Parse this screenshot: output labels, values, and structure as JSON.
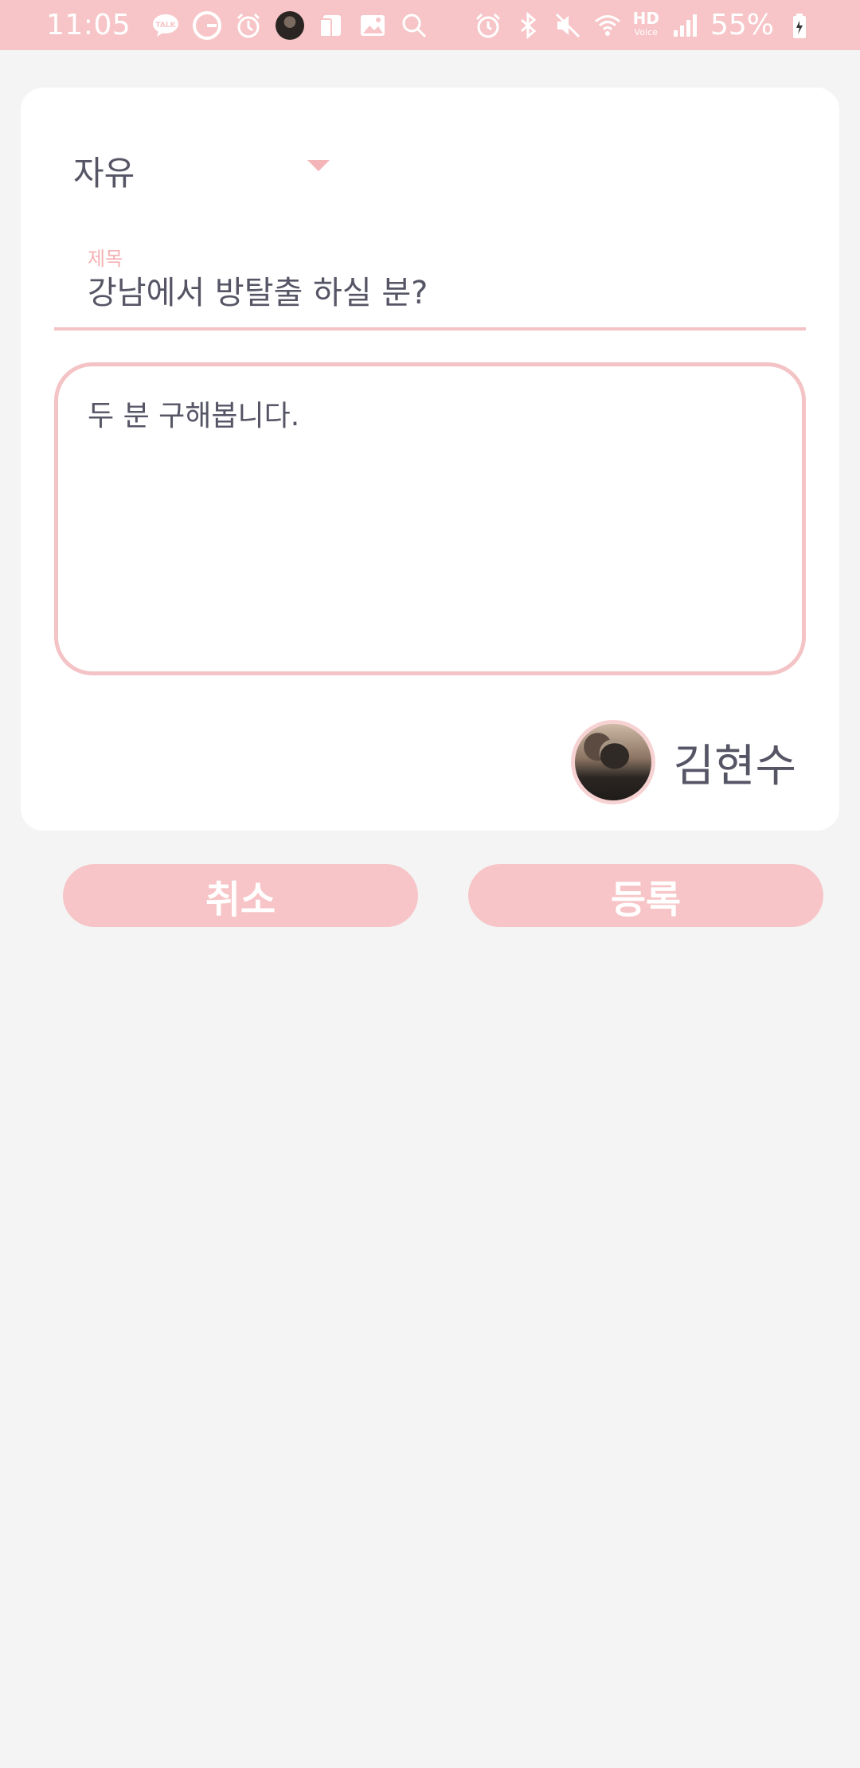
{
  "status_bar": {
    "time": "11:05",
    "left_icons": [
      "talk-icon",
      "google-icon",
      "alarm-app-icon",
      "contact-avatar-icon",
      "notes-icon",
      "gallery-icon",
      "search-icon"
    ],
    "right_icons": [
      "alarm-icon",
      "bluetooth-icon",
      "mute-icon",
      "wifi-icon",
      "hd-voice-icon",
      "signal-icon",
      "battery-icon"
    ],
    "hd_label": "HD",
    "hd_sub": "Voice",
    "battery": "55%"
  },
  "form": {
    "category": "자유",
    "title_label": "제목",
    "title_value": "강남에서 방탈출 하실 분?",
    "body_value": "두 분 구해봅니다."
  },
  "author": {
    "name": "김현수"
  },
  "actions": {
    "cancel_label": "취소",
    "submit_label": "등록"
  },
  "colors": {
    "accent": "#f7c5c7",
    "border": "#f4c3c5",
    "text": "#555566",
    "background": "#f4f4f4"
  }
}
